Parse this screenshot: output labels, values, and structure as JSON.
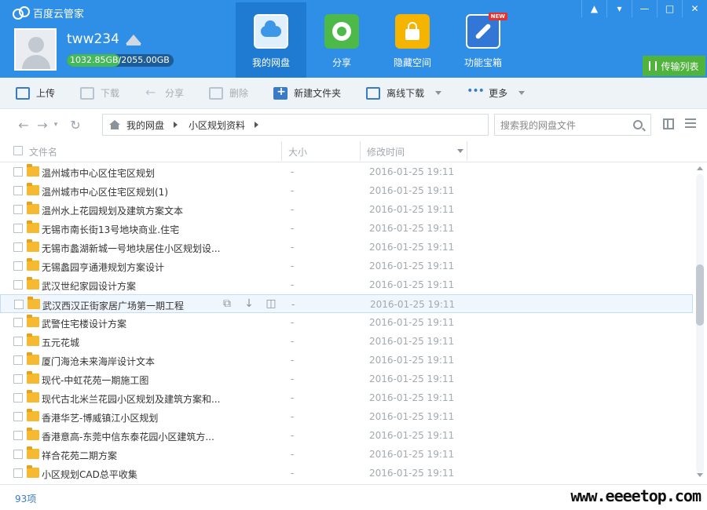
{
  "app": {
    "title": "百度云管家"
  },
  "user": {
    "name": "tww234",
    "quota_used": "1032.85GB",
    "quota_sep": "/",
    "quota_total": "2055.00GB",
    "quota_fraction": 0.5026
  },
  "nav": [
    {
      "label": "我的网盘",
      "icon": "cloud-drive-icon",
      "active": true
    },
    {
      "label": "分享",
      "icon": "share-icon"
    },
    {
      "label": "隐藏空间",
      "icon": "lock-icon"
    },
    {
      "label": "功能宝箱",
      "icon": "toolbox-icon",
      "badge": "NEW"
    }
  ],
  "window_controls": [
    "notification-icon",
    "menu-icon",
    "minimize-icon",
    "maximize-icon",
    "close-icon"
  ],
  "transfer_list": "传输列表",
  "toolbar": {
    "upload": "上传",
    "download": "下载",
    "share": "分享",
    "delete": "删除",
    "new_folder": "新建文件夹",
    "offline_download": "离线下载",
    "more": "更多"
  },
  "breadcrumb": [
    "我的网盘",
    "小区规划资料"
  ],
  "search": {
    "placeholder": "搜索我的网盘文件"
  },
  "columns": {
    "name": "文件名",
    "size": "大小",
    "modified": "修改时间"
  },
  "files": [
    {
      "name": "温州城市中心区住宅区规划",
      "size": "-",
      "modified": "2016-01-25 19:11"
    },
    {
      "name": "温州城市中心区住宅区规划(1)",
      "size": "-",
      "modified": "2016-01-25 19:11"
    },
    {
      "name": "温州水上花园规划及建筑方案文本",
      "size": "-",
      "modified": "2016-01-25 19:11"
    },
    {
      "name": "无锡市南长街13号地块商业.住宅",
      "size": "-",
      "modified": "2016-01-25 19:11"
    },
    {
      "name": "无锡市蠡湖新城一号地块居住小区规划设...",
      "size": "-",
      "modified": "2016-01-25 19:11"
    },
    {
      "name": "无锡蠡园亨通港规划方案设计",
      "size": "-",
      "modified": "2016-01-25 19:11"
    },
    {
      "name": "武汉世纪家园设计方案",
      "size": "-",
      "modified": "2016-01-25 19:11"
    },
    {
      "name": "武汉西汉正街家居广场第一期工程",
      "size": "-",
      "modified": "2016-01-25 19:11",
      "hover": true
    },
    {
      "name": "武警住宅楼设计方案",
      "size": "-",
      "modified": "2016-01-25 19:11"
    },
    {
      "name": "五元花城",
      "size": "-",
      "modified": "2016-01-25 19:11"
    },
    {
      "name": "厦门海沧未来海岸设计文本",
      "size": "-",
      "modified": "2016-01-25 19:11"
    },
    {
      "name": "现代-中虹花苑一期施工图",
      "size": "-",
      "modified": "2016-01-25 19:11"
    },
    {
      "name": "现代古北米兰花园小区规划及建筑方案和...",
      "size": "-",
      "modified": "2016-01-25 19:11"
    },
    {
      "name": "香港华艺-博威镇江小区规划",
      "size": "-",
      "modified": "2016-01-25 19:11"
    },
    {
      "name": "香港意高-东莞中信东泰花园小区建筑方...",
      "size": "-",
      "modified": "2016-01-25 19:11"
    },
    {
      "name": "祥合花苑二期方案",
      "size": "-",
      "modified": "2016-01-25 19:11"
    },
    {
      "name": "小区规划CAD总平收集",
      "size": "-",
      "modified": "2016-01-25 19:11"
    }
  ],
  "scroll_position": 0.38,
  "footer": {
    "count": "93项",
    "watermark": "www.eeeetop.com"
  },
  "colors": {
    "brand_blue": "#2f8fe6",
    "active_nav": "#1f7bd2",
    "quota_green": "#43b95a",
    "transfer_green": "#4fb33c",
    "folder": "#f5b932"
  }
}
